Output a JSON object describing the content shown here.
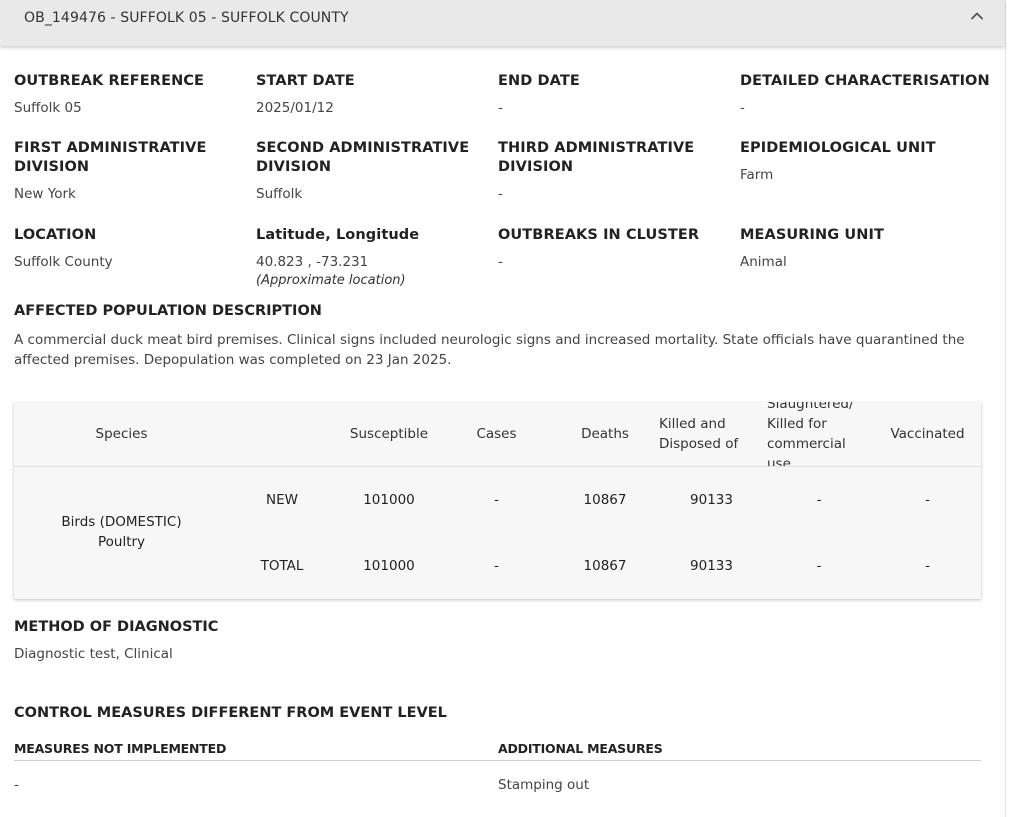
{
  "header": {
    "title": "OB_149476 - SUFFOLK 05 - SUFFOLK COUNTY",
    "collapse_icon": "chevron-up-icon"
  },
  "fields": {
    "outbreak_reference": {
      "label": "OUTBREAK REFERENCE",
      "value": "Suffolk 05"
    },
    "start_date": {
      "label": "START DATE",
      "value": "2025/01/12"
    },
    "end_date": {
      "label": "END DATE",
      "value": "-"
    },
    "detailed_characterisation": {
      "label": "DETAILED CHARACTERISATION",
      "value": "-"
    },
    "first_admin": {
      "label": "FIRST ADMINISTRATIVE DIVISION",
      "value": "New York"
    },
    "second_admin": {
      "label": "SECOND ADMINISTRATIVE DIVISION",
      "value": "Suffolk"
    },
    "third_admin": {
      "label": "THIRD ADMINISTRATIVE DIVISION",
      "value": "-"
    },
    "epi_unit": {
      "label": "EPIDEMIOLOGICAL UNIT",
      "value": "Farm"
    },
    "location": {
      "label": "LOCATION",
      "value": "Suffolk County"
    },
    "lat_long": {
      "label": "Latitude, Longitude",
      "value": "40.823 , -73.231",
      "note": "(Approximate location)"
    },
    "outbreaks_in_cluster": {
      "label": "OUTBREAKS IN CLUSTER",
      "value": "-"
    },
    "measuring_unit": {
      "label": "MEASURING UNIT",
      "value": "Animal"
    }
  },
  "affected_population": {
    "title": "AFFECTED POPULATION DESCRIPTION",
    "text": "A commercial duck meat bird premises. Clinical signs included neurologic signs and increased mortality. State officials have quarantined the affected premises. Depopulation was completed on 23 Jan 2025."
  },
  "table": {
    "headers": {
      "species": "Species",
      "susceptible": "Susceptible",
      "cases": "Cases",
      "deaths": "Deaths",
      "killed": "Killed and Disposed of",
      "slaughtered": "Slaughtered/ Killed for commercial use",
      "vaccinated": "Vaccinated"
    },
    "species": "Birds (DOMESTIC) Poultry",
    "rows": [
      {
        "type": "NEW",
        "susceptible": "101000",
        "cases": "-",
        "deaths": "10867",
        "killed": "90133",
        "slaughtered": "-",
        "vaccinated": "-"
      },
      {
        "type": "TOTAL",
        "susceptible": "101000",
        "cases": "-",
        "deaths": "10867",
        "killed": "90133",
        "slaughtered": "-",
        "vaccinated": "-"
      }
    ]
  },
  "diagnostic": {
    "title": "METHOD OF DIAGNOSTIC",
    "value": "Diagnostic test, Clinical"
  },
  "control_measures": {
    "title": "CONTROL MEASURES DIFFERENT FROM EVENT LEVEL",
    "not_implemented_label": "MEASURES NOT IMPLEMENTED",
    "not_implemented_value": "-",
    "additional_label": "ADDITIONAL MEASURES",
    "additional_value": "Stamping out"
  }
}
